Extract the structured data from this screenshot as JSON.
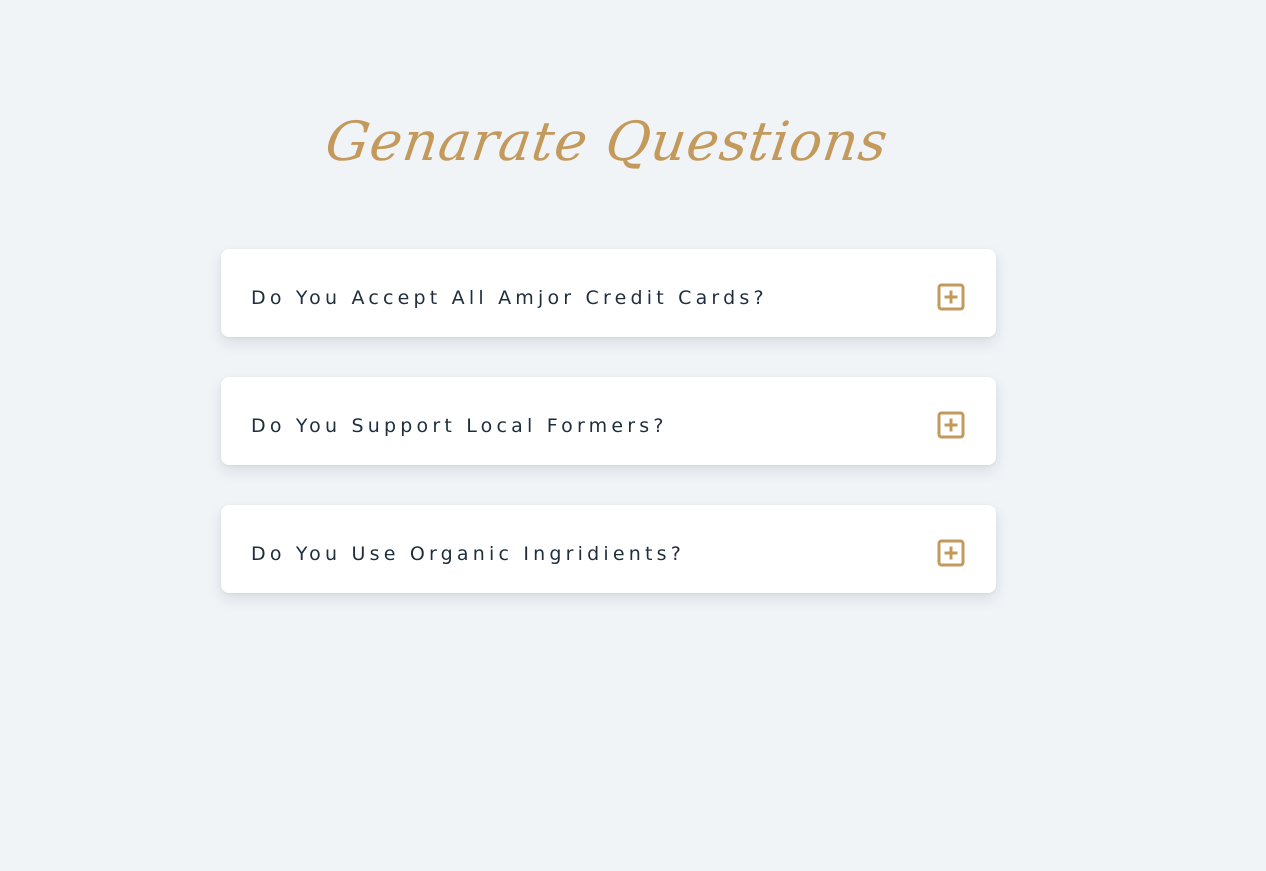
{
  "page": {
    "title": "Genarate Questions"
  },
  "faq": {
    "items": [
      {
        "question": "Do You Accept All Amjor Credit Cards?",
        "icon": "plus-square-icon"
      },
      {
        "question": "Do You Support Local Formers?",
        "icon": "plus-square-icon"
      },
      {
        "question": "Do You Use Organic Ingridients?",
        "icon": "plus-square-icon"
      }
    ]
  },
  "colors": {
    "background": "#f0f4f7",
    "accent": "#c49a5c",
    "text": "#1f2d3d",
    "card": "#ffffff"
  }
}
